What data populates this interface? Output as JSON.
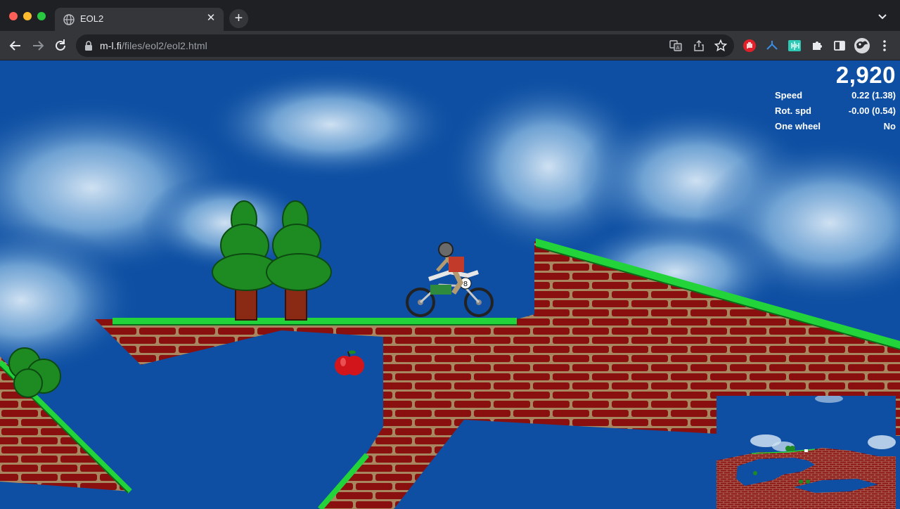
{
  "browser": {
    "tab_title": "EOL2",
    "url_host": "m-l.fi",
    "url_path": "/files/eol2/eol2.html"
  },
  "icons": {
    "back": "arrow-left-icon",
    "forward": "arrow-right-icon",
    "reload": "reload-icon",
    "lock": "lock-icon",
    "translate": "translate-icon",
    "share": "share-icon",
    "bookmark": "star-icon",
    "extensions": "puzzle-icon",
    "sidepanel": "side-panel-icon",
    "menu": "kebab-menu-icon"
  },
  "hud": {
    "score": "2,920",
    "stats": [
      {
        "label": "Speed",
        "value": "0.22 (1.38)"
      },
      {
        "label": "Rot. spd",
        "value": "-0.00 (0.54)"
      },
      {
        "label": "One wheel",
        "value": "No"
      }
    ]
  },
  "colors": {
    "sky": "#0e4fa3",
    "grass": "#22d43a",
    "brick": "#8a1010",
    "mortar": "#a88660",
    "apple": "#d2151b"
  }
}
